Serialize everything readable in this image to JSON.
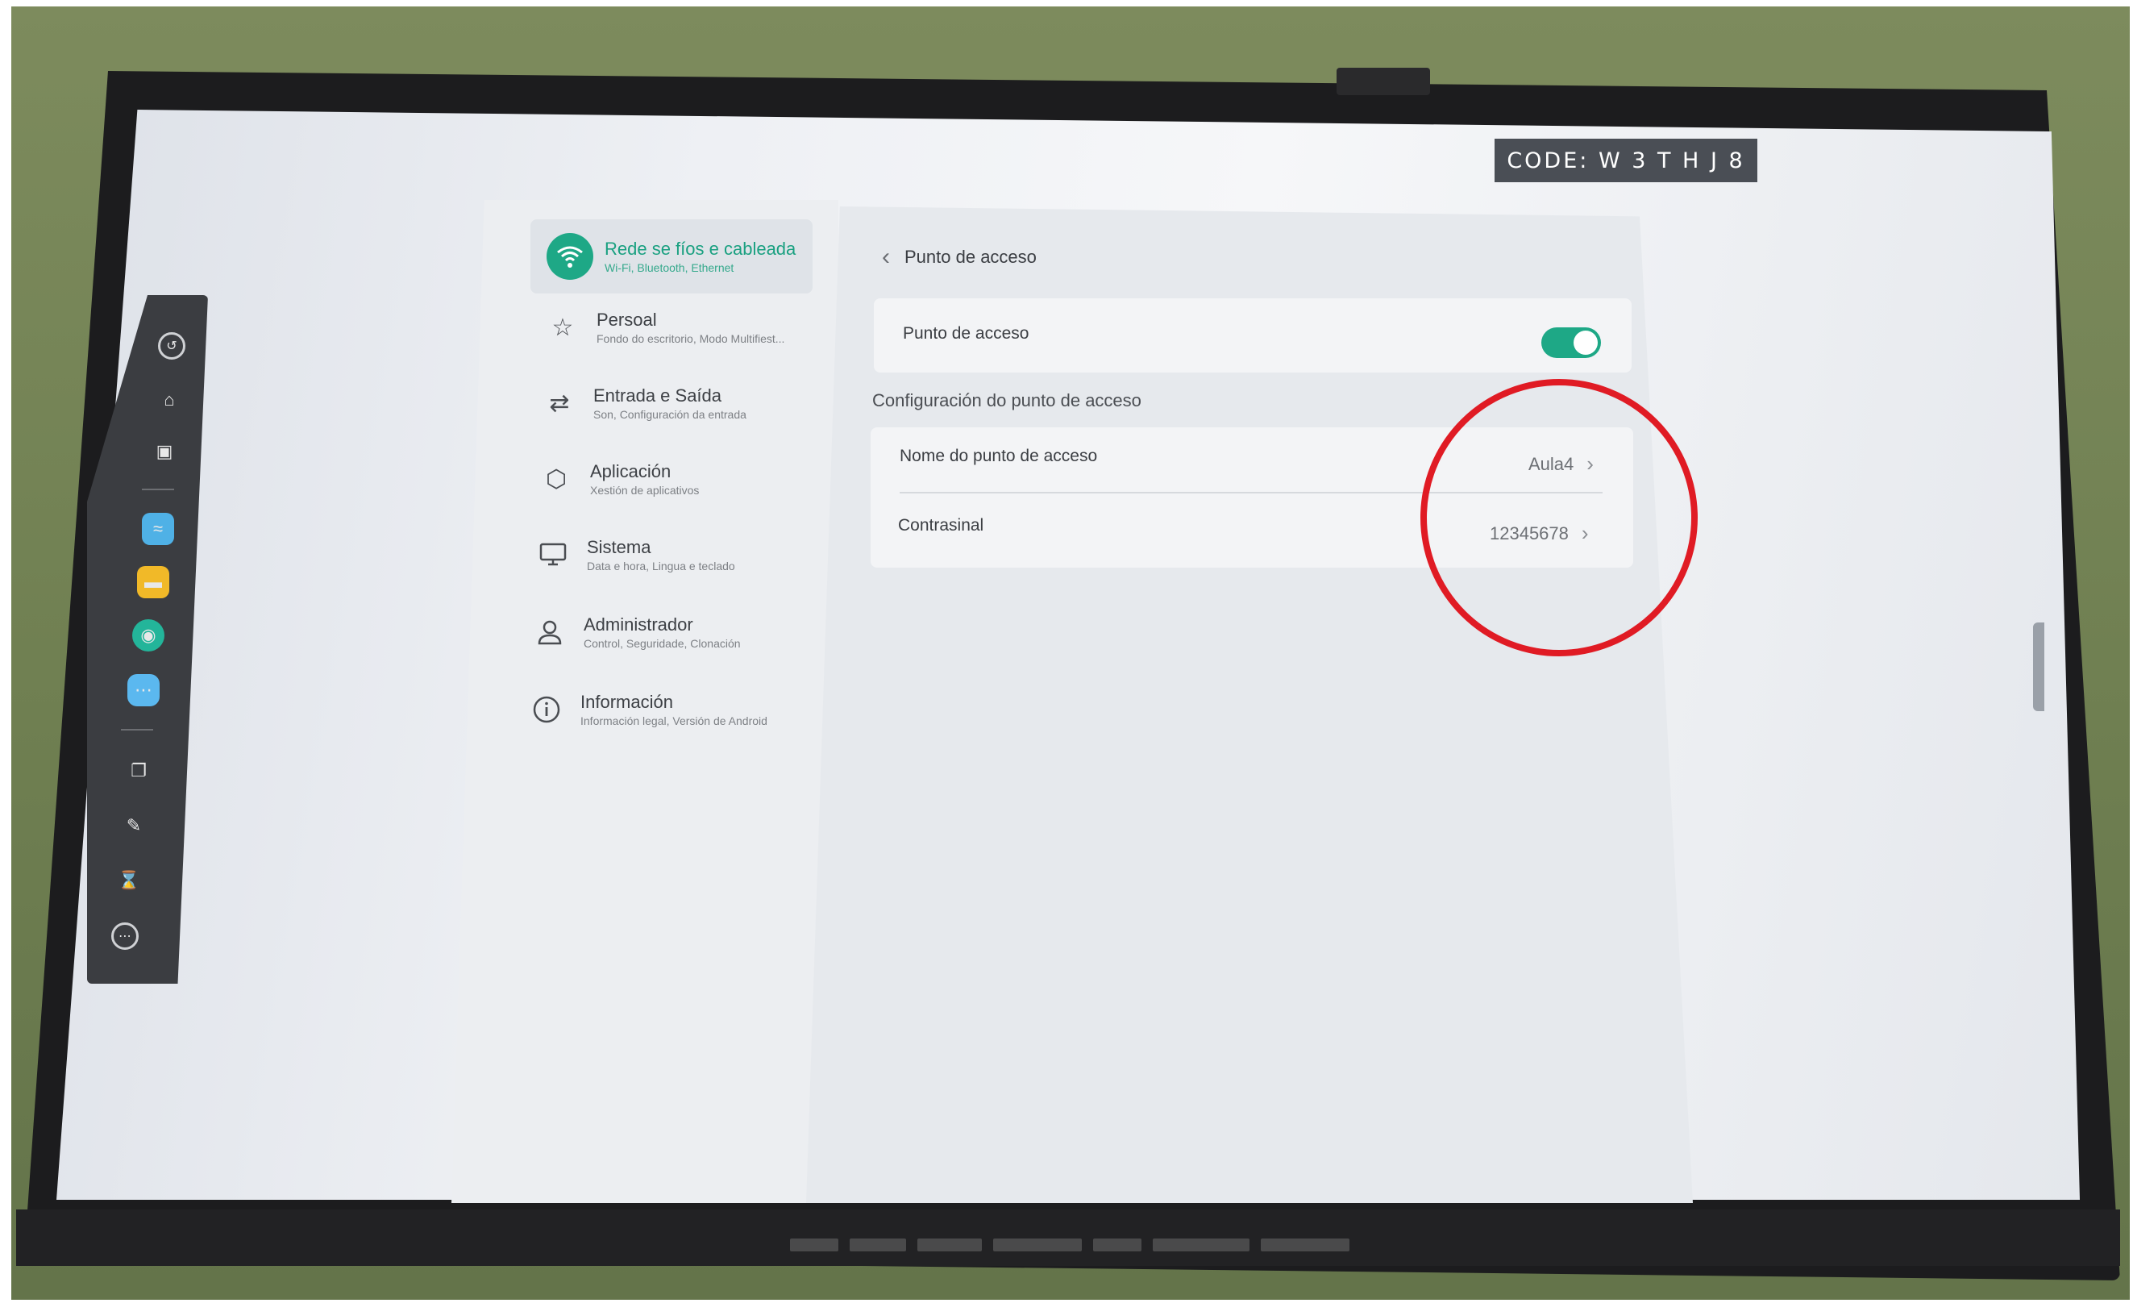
{
  "badge": {
    "code": "CODE: W 3 T H J 8"
  },
  "dock": {
    "items": [
      "back-icon",
      "home-icon",
      "window-icon",
      "whiteboard-app-icon",
      "notes-app-icon",
      "camera-app-icon",
      "apps-grid-icon",
      "screens-icon",
      "pen-icon",
      "timer-icon",
      "more-icon"
    ]
  },
  "sidebar": {
    "items": [
      {
        "title": "Rede se fíos e cableada",
        "subtitle": "Wi-Fi, Bluetooth, Ethernet",
        "icon": "wifi-icon"
      },
      {
        "title": "Persoal",
        "subtitle": "Fondo do escritorio, Modo Multifiest...",
        "icon": "star-icon"
      },
      {
        "title": "Entrada e Saída",
        "subtitle": "Son, Configuración da entrada",
        "icon": "swap-arrows-icon"
      },
      {
        "title": "Aplicación",
        "subtitle": "Xestión de aplicativos",
        "icon": "cube-icon"
      },
      {
        "title": "Sistema",
        "subtitle": "Data e hora, Lingua e teclado",
        "icon": "monitor-icon"
      },
      {
        "title": "Administrador",
        "subtitle": "Control, Seguridade, Clonación",
        "icon": "user-icon"
      },
      {
        "title": "Información",
        "subtitle": "Información legal, Versión de Android",
        "icon": "info-icon"
      }
    ]
  },
  "content": {
    "header": "Punto de acceso",
    "hotspot_toggle": {
      "label": "Punto de acceso",
      "enabled": true
    },
    "section_title": "Configuración do punto de acceso",
    "name_row": {
      "label": "Nome do punto de acceso",
      "value": "Aula4"
    },
    "password_row": {
      "label": "Contrasinal",
      "value": "12345678"
    }
  },
  "colors": {
    "accent": "#1ea886",
    "annotation": "#e01b24"
  }
}
